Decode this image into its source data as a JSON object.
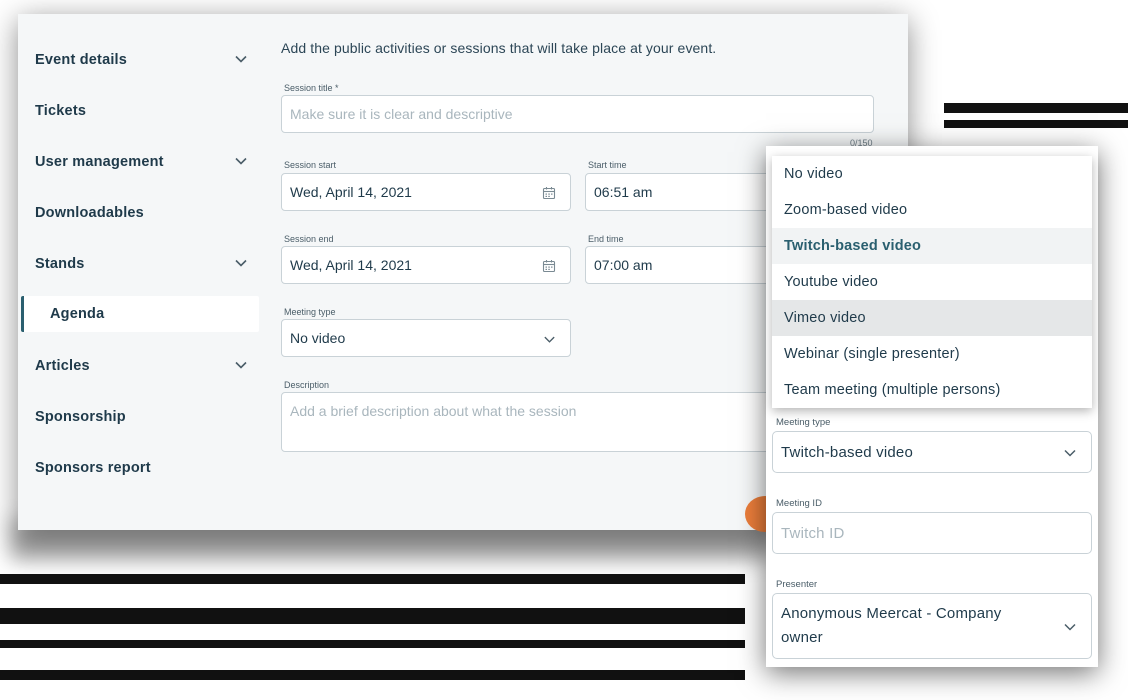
{
  "sidebar": {
    "items": [
      {
        "label": "Event details",
        "has_chevron": true
      },
      {
        "label": "Tickets",
        "has_chevron": false
      },
      {
        "label": "User management",
        "has_chevron": true
      },
      {
        "label": "Downloadables",
        "has_chevron": false
      },
      {
        "label": "Stands",
        "has_chevron": true
      },
      {
        "label": "Agenda",
        "active": true
      },
      {
        "label": "Articles",
        "has_chevron": true
      },
      {
        "label": "Sponsorship",
        "has_chevron": false
      },
      {
        "label": "Sponsors report",
        "has_chevron": false
      }
    ]
  },
  "form": {
    "intro": "Add the public activities or sessions that will take place at your event.",
    "session_title": {
      "label": "Session title *",
      "placeholder": "Make sure it is clear and descriptive",
      "counter": "0/150"
    },
    "session_start": {
      "label": "Session start",
      "value": "Wed, April 14, 2021"
    },
    "start_time": {
      "label": "Start time",
      "value": "06:51 am"
    },
    "session_end": {
      "label": "Session end",
      "value": "Wed, April 14, 2021"
    },
    "end_time": {
      "label": "End time",
      "value": "07:00 am"
    },
    "meeting_type": {
      "label": "Meeting type",
      "value": "No video"
    },
    "description": {
      "label": "Description",
      "placeholder": "Add a brief description about what the session"
    }
  },
  "panel": {
    "dropdown_options": [
      "No video",
      "Zoom-based video",
      "Twitch-based video",
      "Youtube video",
      "Vimeo video",
      "Webinar (single presenter)",
      "Team meeting (multiple persons)"
    ],
    "selected_option": "Twitch-based video",
    "hovered_option": "Vimeo video",
    "meeting_type": {
      "label": "Meeting type",
      "value": "Twitch-based video"
    },
    "meeting_id": {
      "label": "Meeting ID",
      "placeholder": "Twitch ID"
    },
    "presenter": {
      "label": "Presenter",
      "value": "Anonymous Meercat - Company owner"
    }
  },
  "colors": {
    "accent": "#2a5f6f",
    "text": "#1f3a4a",
    "orange": "#ec7e3b",
    "background": "#f5f7f8"
  },
  "icons": {
    "chevron": "chevron-down-icon",
    "calendar": "calendar-icon"
  }
}
